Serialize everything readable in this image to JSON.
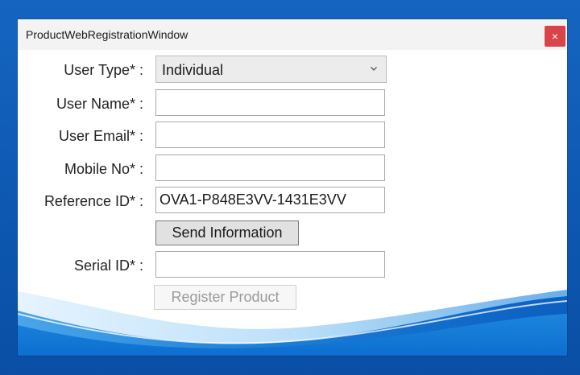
{
  "window": {
    "title": "ProductWebRegistrationWindow",
    "close_label": "×"
  },
  "form": {
    "user_type_label": "User Type* :",
    "user_type_value": "Individual",
    "user_name_label": "User Name* :",
    "user_name_value": "",
    "user_email_label": "User Email* :",
    "user_email_value": "",
    "mobile_label": "Mobile No* :",
    "mobile_value": "",
    "reference_label": "Reference ID* :",
    "reference_value": "OVA1-P848E3VV-1431E3VV",
    "send_button_label": "Send Information",
    "serial_label": "Serial ID* :",
    "serial_value": "",
    "register_button_label": "Register Product"
  },
  "icons": {
    "close": "close-icon",
    "dropdown": "chevron-down-icon"
  },
  "colors": {
    "desktop_background": "#1565c0",
    "close_button": "#d9434a",
    "wave_dark": "#0b63c4",
    "wave_light": "#4fb0f0"
  }
}
